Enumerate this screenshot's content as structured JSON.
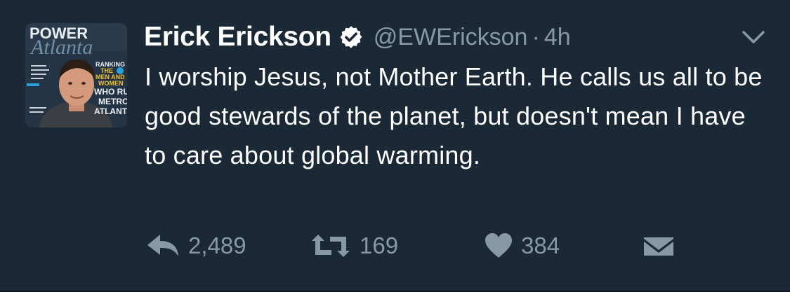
{
  "tweet": {
    "avatar": {
      "magazine_masthead": "POWER",
      "magazine_title": "Atlanta",
      "cover_lines": [
        "RANKING",
        "THE",
        "MEN AND",
        "WOMEN",
        "WHO RUN",
        "METRO",
        "ATLANTA"
      ]
    },
    "author": {
      "name": "Erick Erickson",
      "verified": true,
      "handle": "@EWErickson",
      "separator": "·",
      "time": "4h"
    },
    "text": "I worship Jesus, not Mother Earth. He calls us all to be good stewards of the planet, but doesn't mean I have to care about global warming.",
    "actions": {
      "reply_count": "2,489",
      "retweet_count": "169",
      "like_count": "384"
    }
  },
  "colors": {
    "background": "#1b2836",
    "text_primary": "#ffffff",
    "text_secondary": "#8899a6",
    "verified_badge": "#ffffff"
  },
  "icons": {
    "verified": "verified-badge-icon",
    "menu": "chevron-down-icon",
    "reply": "reply-icon",
    "retweet": "retweet-icon",
    "like": "heart-icon",
    "dm": "envelope-icon"
  }
}
